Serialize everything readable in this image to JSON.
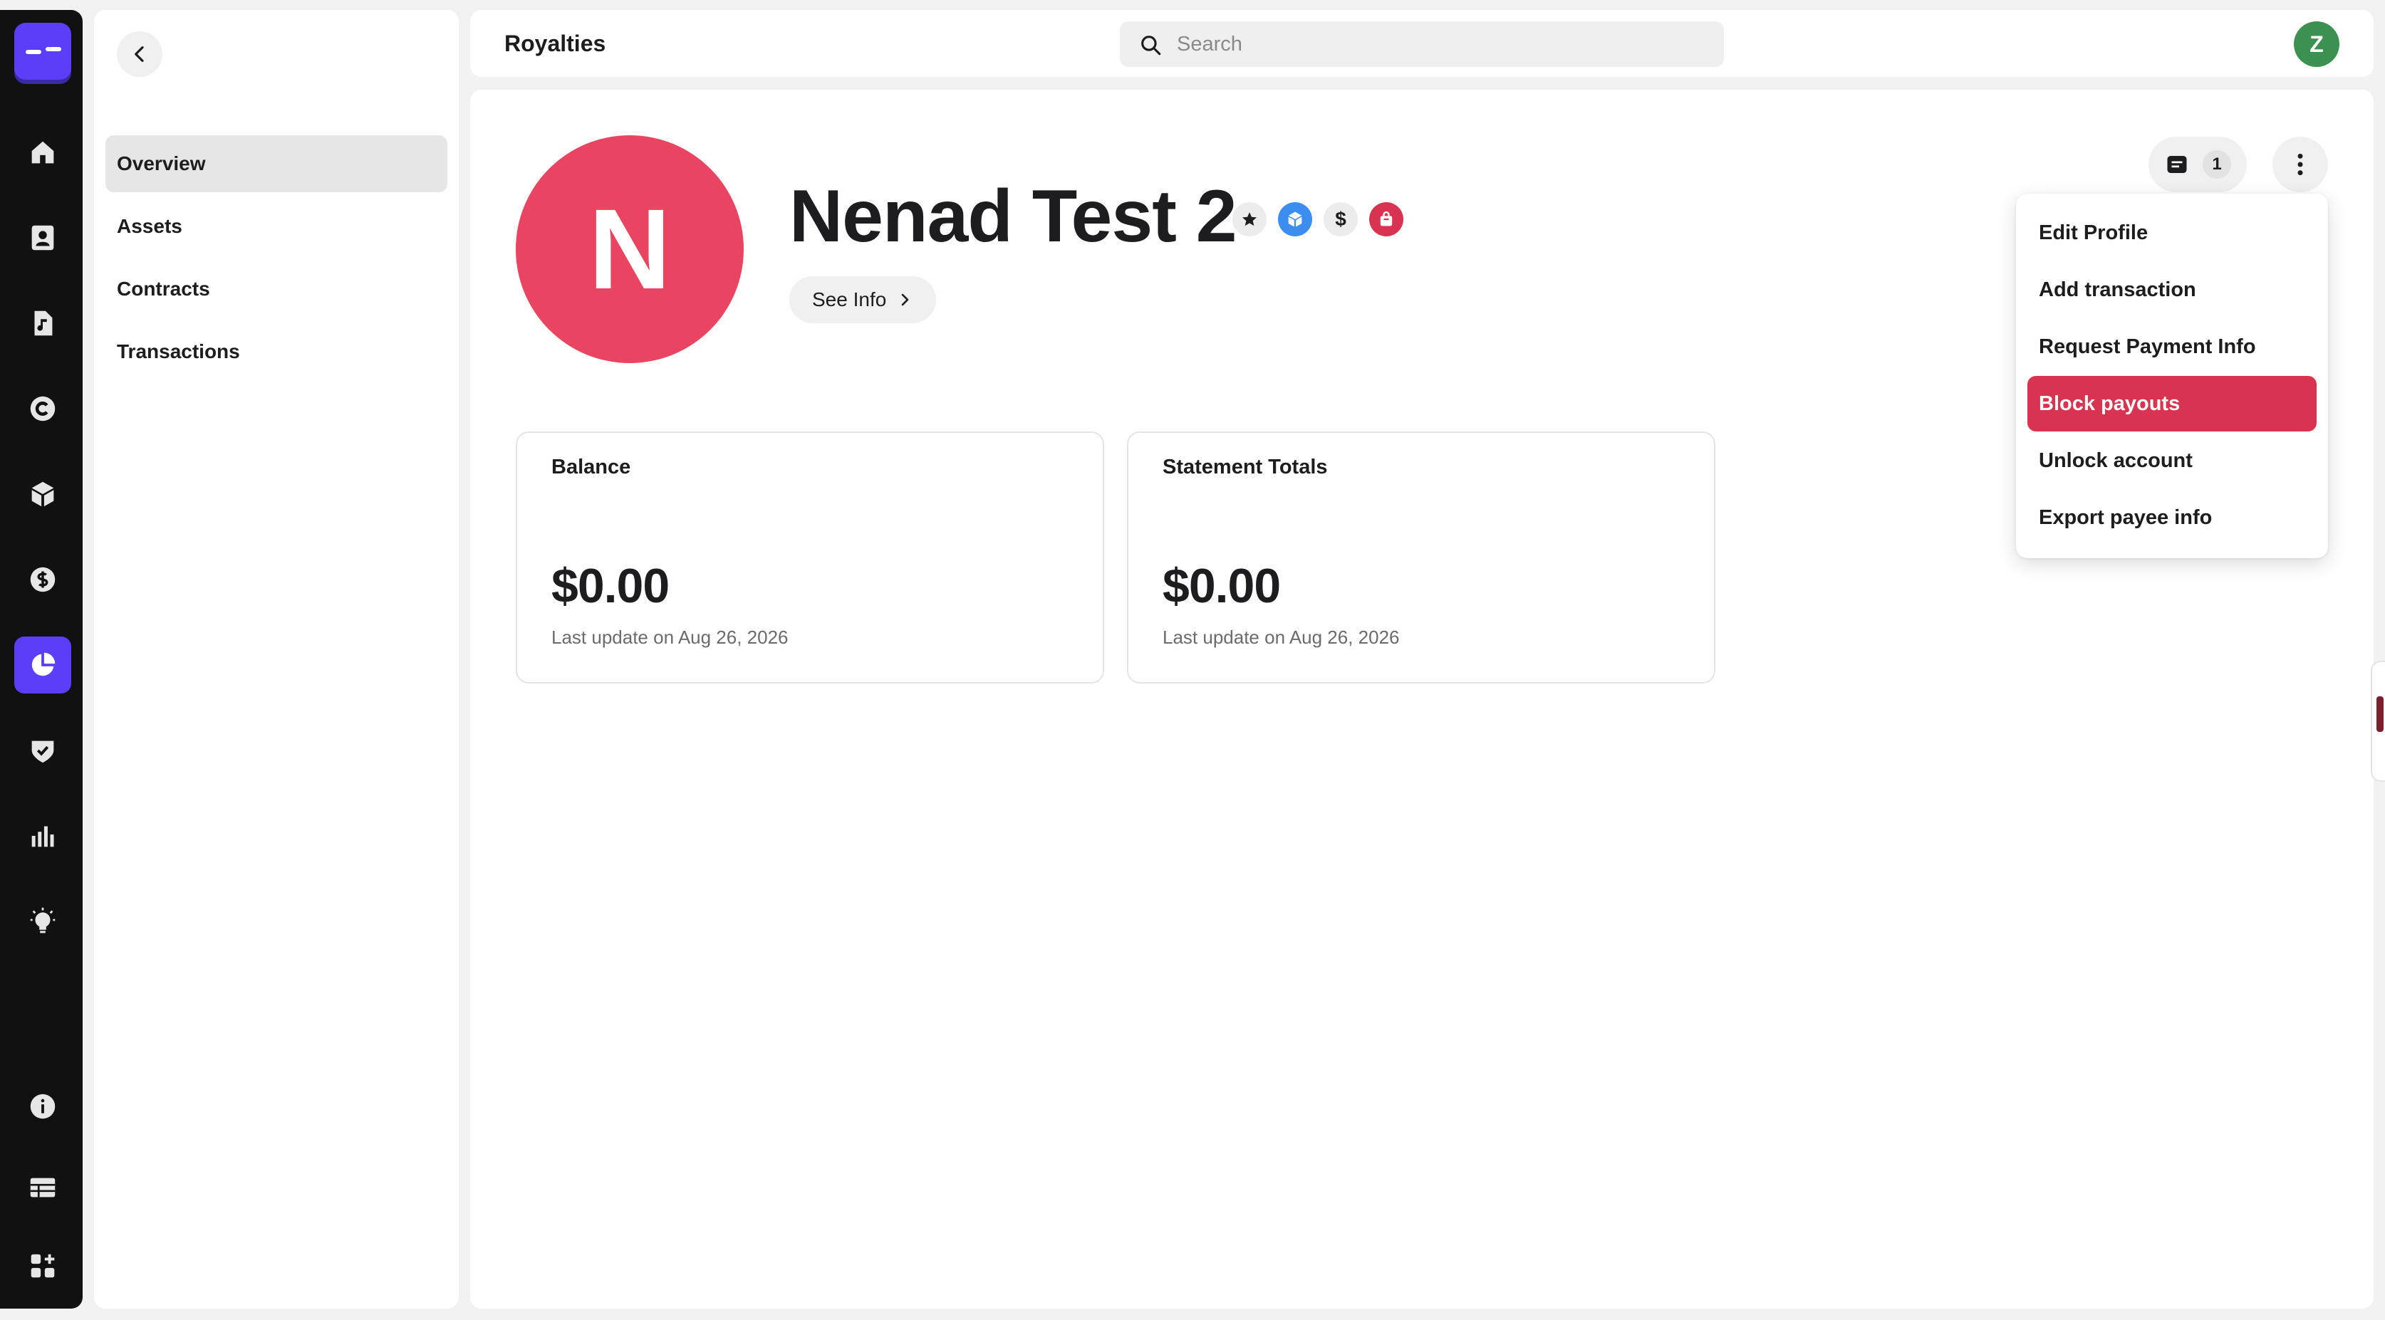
{
  "header": {
    "title": "Royalties",
    "search_placeholder": "Search",
    "user_initial": "Z"
  },
  "rail": {
    "icons": [
      "home-icon",
      "contacts-icon",
      "music-note-icon",
      "copyright-icon",
      "box-icon",
      "dollar-icon",
      "pie-chart-icon",
      "shield-check-icon",
      "bar-chart-icon",
      "lightbulb-icon",
      "info-icon",
      "table-icon",
      "apps-icon"
    ],
    "active": "pie-chart-icon",
    "accent": "#5b3ef5"
  },
  "subnav": {
    "items": [
      {
        "label": "Overview",
        "active": true
      },
      {
        "label": "Assets",
        "active": false
      },
      {
        "label": "Contracts",
        "active": false
      },
      {
        "label": "Transactions",
        "active": false
      }
    ]
  },
  "profile": {
    "initial": "N",
    "name": "Nenad Test 2",
    "avatar_color": "#e94560",
    "badges": [
      "star-icon",
      "cube-icon",
      "dollar-icon",
      "shopping-bag-icon"
    ],
    "badge_dollar_symbol": "$",
    "see_info_label": "See Info"
  },
  "cards": [
    {
      "title": "Balance",
      "amount": "$0.00",
      "subtitle": "Last update on Aug 26, 2026"
    },
    {
      "title": "Statement Totals",
      "amount": "$0.00",
      "subtitle": "Last update on Aug 26, 2026"
    }
  ],
  "actions": {
    "message_count": "1"
  },
  "menu": {
    "items": [
      {
        "label": "Edit Profile",
        "highlighted": false
      },
      {
        "label": "Add transaction",
        "highlighted": false
      },
      {
        "label": "Request Payment Info",
        "highlighted": false
      },
      {
        "label": "Block payouts",
        "highlighted": true
      },
      {
        "label": "Unlock account",
        "highlighted": false
      },
      {
        "label": "Export payee info",
        "highlighted": false
      }
    ],
    "highlight_color": "#d8344f"
  }
}
